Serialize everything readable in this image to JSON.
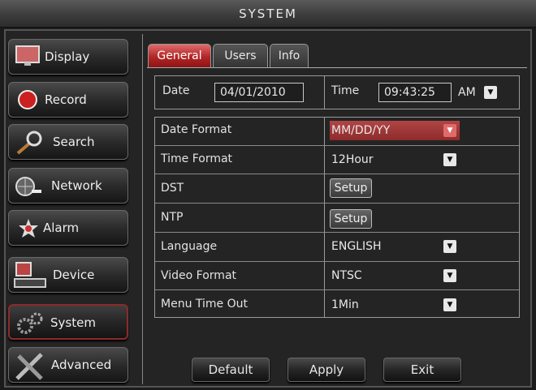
{
  "window": {
    "title": "SYSTEM"
  },
  "sidebar": {
    "items": [
      {
        "label": "Display",
        "icon": "monitor-icon"
      },
      {
        "label": "Record",
        "icon": "record-icon"
      },
      {
        "label": "Search",
        "icon": "magnifier-icon"
      },
      {
        "label": "Network",
        "icon": "globe-network-icon"
      },
      {
        "label": "Alarm",
        "icon": "alarm-icon"
      },
      {
        "label": "Device",
        "icon": "device-icon"
      },
      {
        "label": "System",
        "icon": "gears-icon",
        "active": true
      },
      {
        "label": "Advanced",
        "icon": "tools-icon"
      }
    ]
  },
  "tabs": [
    {
      "label": "General",
      "active": true
    },
    {
      "label": "Users"
    },
    {
      "label": "Info"
    }
  ],
  "datetime": {
    "date_label": "Date",
    "date_value": "04/01/2010",
    "time_label": "Time",
    "time_value": "09:43:25",
    "ampm_value": "AM"
  },
  "settings": [
    {
      "label": "Date Format",
      "value": "MM/DD/YY",
      "kind": "select",
      "highlighted": true
    },
    {
      "label": "Time Format",
      "value": "12Hour",
      "kind": "select"
    },
    {
      "label": "DST",
      "value": "Setup",
      "kind": "button"
    },
    {
      "label": "NTP",
      "value": "Setup",
      "kind": "button"
    },
    {
      "label": "Language",
      "value": "ENGLISH",
      "kind": "select"
    },
    {
      "label": "Video Format",
      "value": "NTSC",
      "kind": "select"
    },
    {
      "label": "Menu Time Out",
      "value": "1Min",
      "kind": "select"
    }
  ],
  "footer": {
    "default_label": "Default",
    "apply_label": "Apply",
    "exit_label": "Exit"
  },
  "colors": {
    "accent": "#b02424",
    "background": "#1b1b1b",
    "text": "#e6e6e6"
  }
}
